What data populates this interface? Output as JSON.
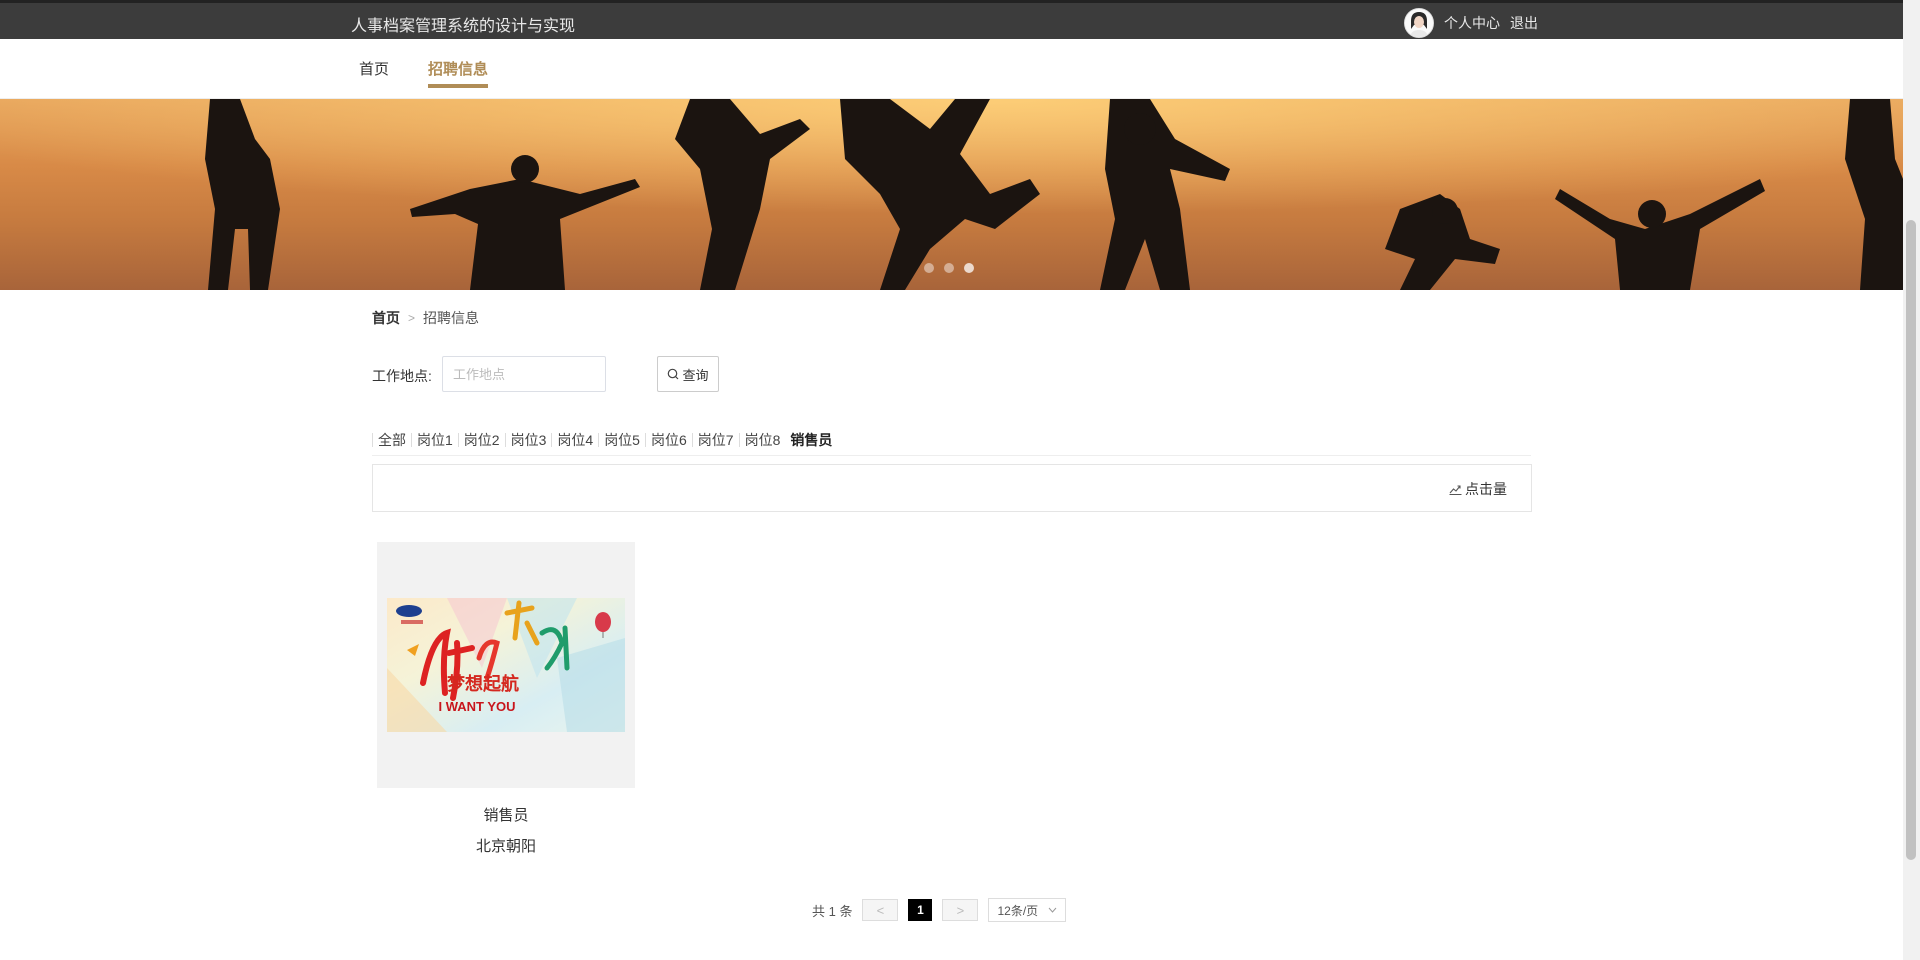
{
  "header": {
    "system_title": "人事档案管理系统的设计与实现",
    "personal_center": "个人中心",
    "logout": "退出"
  },
  "nav": {
    "items": [
      {
        "label": "首页",
        "active": false
      },
      {
        "label": "招聘信息",
        "active": true
      }
    ],
    "accent_color": "#b08d57"
  },
  "banner": {
    "slide_count": 3,
    "active_slide": 3
  },
  "breadcrumb": {
    "home": "首页",
    "separator": ">",
    "current": "招聘信息"
  },
  "search": {
    "label": "工作地点:",
    "placeholder": "工作地点",
    "value": "",
    "button_label": "查询",
    "button_icon": "search-icon"
  },
  "categories": {
    "items": [
      "全部",
      "岗位1",
      "岗位2",
      "岗位3",
      "岗位4",
      "岗位5",
      "岗位6",
      "岗位7",
      "岗位8",
      "销售员"
    ],
    "active": "销售员"
  },
  "sort": {
    "label": "点击量",
    "icon": "trend-chart-icon"
  },
  "jobs": [
    {
      "title": "销售员",
      "location": "北京朝阳",
      "poster_text": "I WANT YOU",
      "poster_headline": "加入我们 梦想起航"
    }
  ],
  "pagination": {
    "total_text": "共 1 条",
    "prev": "<",
    "current_page": "1",
    "next": ">",
    "page_size": "12条/页"
  }
}
